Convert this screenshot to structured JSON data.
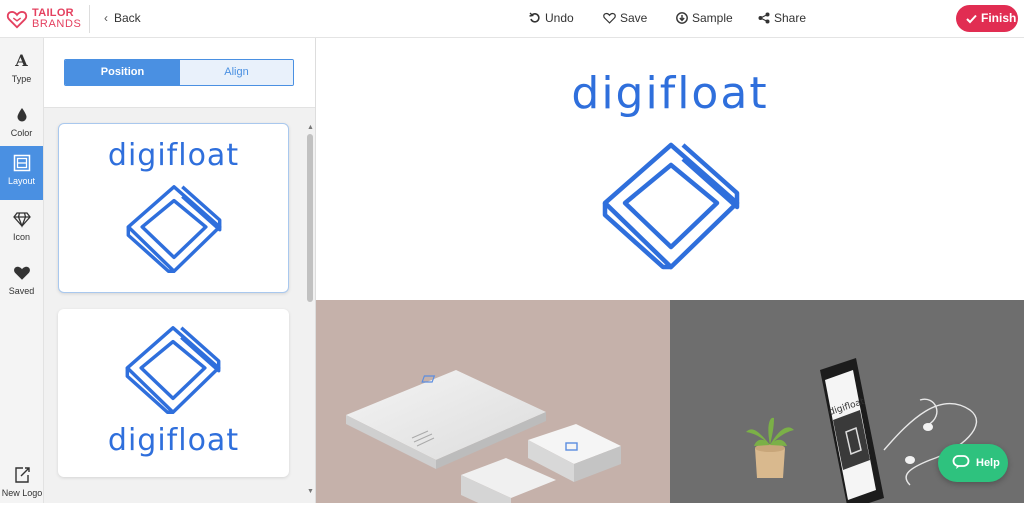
{
  "brand": {
    "line1": "TAILOR",
    "line2": "BRANDS",
    "color": "#e4405f"
  },
  "header": {
    "back_label": "Back",
    "actions": [
      {
        "label": "Undo",
        "icon": "undo-icon"
      },
      {
        "label": "Save",
        "icon": "heart-icon"
      },
      {
        "label": "Sample",
        "icon": "download-icon"
      },
      {
        "label": "Share",
        "icon": "share-icon"
      }
    ],
    "finish_label": "Finish"
  },
  "sidebar": {
    "items": [
      {
        "label": "Type",
        "icon": "type-icon"
      },
      {
        "label": "Color",
        "icon": "droplet-icon"
      },
      {
        "label": "Layout",
        "icon": "layout-icon",
        "active": true
      },
      {
        "label": "Icon",
        "icon": "diamond-icon"
      },
      {
        "label": "Saved",
        "icon": "heart-icon"
      },
      {
        "label": "New Logo",
        "icon": "new-logo-icon"
      }
    ]
  },
  "panel": {
    "tabs": {
      "position": "Position",
      "align": "Align"
    },
    "cards": [
      {
        "logo_text": "digifloat",
        "layout": "text-top"
      },
      {
        "logo_text": "digifloat",
        "layout": "text-bottom"
      }
    ]
  },
  "preview": {
    "logo_text": "digifloat",
    "accent": "#2f6fdc"
  },
  "mockups": {
    "phone_text": "digifloat"
  },
  "help_label": "Help"
}
